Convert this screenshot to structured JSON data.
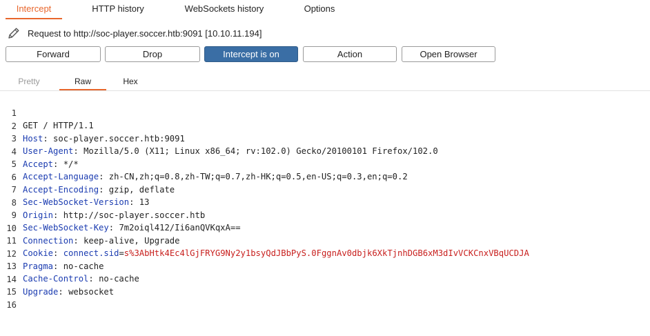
{
  "tabs": [
    {
      "label": "Intercept",
      "active": true
    },
    {
      "label": "HTTP history",
      "active": false
    },
    {
      "label": "WebSockets history",
      "active": false
    },
    {
      "label": "Options",
      "active": false
    }
  ],
  "request_info": "Request to http://soc-player.soccer.htb:9091  [10.10.11.194]",
  "buttons": {
    "forward": "Forward",
    "drop": "Drop",
    "intercept": "Intercept is on",
    "action": "Action",
    "open_browser": "Open Browser"
  },
  "view_tabs": [
    {
      "label": "Pretty",
      "active": false
    },
    {
      "label": "Raw",
      "active": true
    },
    {
      "label": "Hex",
      "active": false
    }
  ],
  "request_lines": [
    {
      "n": "1",
      "key": "",
      "sep": "",
      "val": "GET / HTTP/1.1"
    },
    {
      "n": "2",
      "key": "Host",
      "sep": ": ",
      "val": "soc-player.soccer.htb:9091"
    },
    {
      "n": "3",
      "key": "User-Agent",
      "sep": ": ",
      "val": "Mozilla/5.0 (X11; Linux x86_64; rv:102.0) Gecko/20100101 Firefox/102.0"
    },
    {
      "n": "4",
      "key": "Accept",
      "sep": ": ",
      "val": "*/*"
    },
    {
      "n": "5",
      "key": "Accept-Language",
      "sep": ": ",
      "val": "zh-CN,zh;q=0.8,zh-TW;q=0.7,zh-HK;q=0.5,en-US;q=0.3,en;q=0.2"
    },
    {
      "n": "6",
      "key": "Accept-Encoding",
      "sep": ": ",
      "val": "gzip, deflate"
    },
    {
      "n": "7",
      "key": "Sec-WebSocket-Version",
      "sep": ": ",
      "val": "13"
    },
    {
      "n": "8",
      "key": "Origin",
      "sep": ": ",
      "val": "http://soc-player.soccer.htb"
    },
    {
      "n": "9",
      "key": "Sec-WebSocket-Key",
      "sep": ": ",
      "val": "7m2oiql412/Ii6anQVKqxA=="
    },
    {
      "n": "10",
      "key": "Connection",
      "sep": ": ",
      "val": "keep-alive, Upgrade"
    },
    {
      "n": "11",
      "key": "Cookie",
      "sep": ": ",
      "cookie_name": "connect.sid",
      "cookie_eq": "=",
      "cookie_val": "s%3AbHtk4Ec4lGjFRYG9Ny2y1bsyQdJBbPyS.0FggnAv0dbjk6XkTjnhDGB6xM3dIvVCKCnxVBqUCDJA"
    },
    {
      "n": "12",
      "key": "Pragma",
      "sep": ": ",
      "val": "no-cache"
    },
    {
      "n": "13",
      "key": "Cache-Control",
      "sep": ": ",
      "val": "no-cache"
    },
    {
      "n": "14",
      "key": "Upgrade",
      "sep": ": ",
      "val": "websocket"
    },
    {
      "n": "15",
      "key": "",
      "sep": "",
      "val": ""
    },
    {
      "n": "16",
      "key": "",
      "sep": "",
      "val": ""
    }
  ],
  "colors": {
    "accent": "#e8662c",
    "primary_button": "#3a6ea5",
    "header_key": "#1a3bb0",
    "cookie_value": "#c8201e"
  },
  "icons": {
    "edit": "pencil-icon"
  }
}
